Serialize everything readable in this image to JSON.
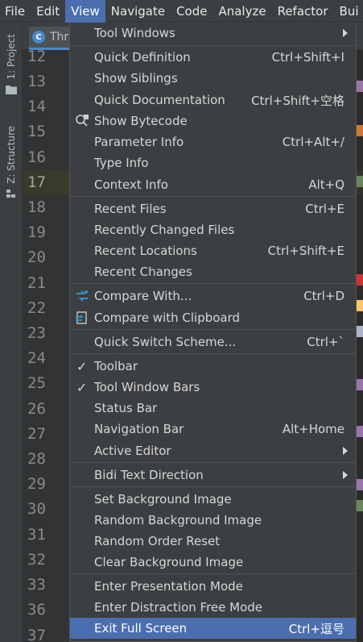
{
  "menubar": {
    "items": [
      {
        "label": "File"
      },
      {
        "label": "Edit"
      },
      {
        "label": "View"
      },
      {
        "label": "Navigate"
      },
      {
        "label": "Code"
      },
      {
        "label": "Analyze"
      },
      {
        "label": "Refactor"
      },
      {
        "label": "Bui"
      }
    ],
    "active": "View"
  },
  "toolstrip": {
    "project_label": "1: Project",
    "structure_label": "Z: Structure"
  },
  "editor": {
    "tab_label": "Thr",
    "tab_icon": "C",
    "line_numbers": [
      "12",
      "13",
      "14",
      "15",
      "16",
      "17",
      "18",
      "19",
      "20",
      "21",
      "22",
      "23",
      "24",
      "25",
      "26",
      "27",
      "28",
      "29",
      "30",
      "31",
      "32",
      "33",
      "36",
      "37"
    ],
    "current_line": "17"
  },
  "menu": {
    "items": [
      {
        "label": "Tool Windows",
        "shortcut": "",
        "submenu": true
      },
      {
        "label": "Quick Definition",
        "shortcut": "Ctrl+Shift+I"
      },
      {
        "label": "Show Siblings",
        "shortcut": ""
      },
      {
        "label": "Quick Documentation",
        "shortcut": "Ctrl+Shift+空格"
      },
      {
        "label": "Show Bytecode",
        "shortcut": ""
      },
      {
        "label": "Parameter Info",
        "shortcut": "Ctrl+Alt+/"
      },
      {
        "label": "Type Info",
        "shortcut": ""
      },
      {
        "label": "Context Info",
        "shortcut": "Alt+Q"
      },
      {
        "label": "Recent Files",
        "shortcut": "Ctrl+E"
      },
      {
        "label": "Recently Changed Files",
        "shortcut": ""
      },
      {
        "label": "Recent Locations",
        "shortcut": "Ctrl+Shift+E"
      },
      {
        "label": "Recent Changes",
        "shortcut": ""
      },
      {
        "label": "Compare With...",
        "shortcut": "Ctrl+D"
      },
      {
        "label": "Compare with Clipboard",
        "shortcut": ""
      },
      {
        "label": "Quick Switch Scheme...",
        "shortcut": "Ctrl+`"
      },
      {
        "label": "Toolbar",
        "shortcut": "",
        "checked": true
      },
      {
        "label": "Tool Window Bars",
        "shortcut": "",
        "checked": true
      },
      {
        "label": "Status Bar",
        "shortcut": ""
      },
      {
        "label": "Navigation Bar",
        "shortcut": "Alt+Home"
      },
      {
        "label": "Active Editor",
        "shortcut": "",
        "submenu": true
      },
      {
        "label": "Bidi Text Direction",
        "shortcut": "",
        "submenu": true
      },
      {
        "label": "Set Background Image",
        "shortcut": ""
      },
      {
        "label": "Random Background Image",
        "shortcut": ""
      },
      {
        "label": "Random Order Reset",
        "shortcut": ""
      },
      {
        "label": "Clear Background Image",
        "shortcut": ""
      },
      {
        "label": "Enter Presentation Mode",
        "shortcut": ""
      },
      {
        "label": "Enter Distraction Free Mode",
        "shortcut": ""
      },
      {
        "label": "Exit Full Screen",
        "shortcut": "Ctrl+逗号",
        "highlighted": true
      }
    ]
  },
  "colors": {
    "menu_bg": "#3c3f41",
    "highlight": "#4b6eaf",
    "editor_bg": "#2b2b2b",
    "gutter_bg": "#313335"
  }
}
